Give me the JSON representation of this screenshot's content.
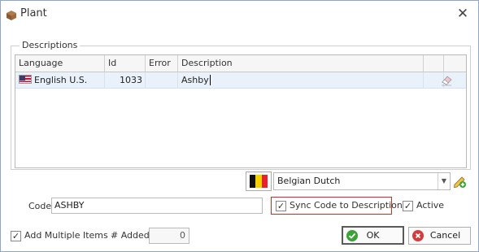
{
  "window": {
    "title": "Plant",
    "close_glyph": "✕"
  },
  "descriptions": {
    "group_label": "Descriptions",
    "columns": [
      "Language",
      "Id",
      "Error",
      "Description"
    ],
    "rows": [
      {
        "language": "English U.S.",
        "id": "1033",
        "error": "",
        "description": "Ashby"
      }
    ],
    "language_selector": {
      "value": "Belgian Dutch"
    }
  },
  "form": {
    "code_label": "Code",
    "code_value": "ASHBY",
    "sync_label": "Sync Code to Description",
    "sync_checked": true,
    "active_label": "Active",
    "active_checked": true,
    "add_multiple_label": "Add Multiple Items",
    "add_multiple_checked": true,
    "added_label": "# Added",
    "added_value": "0"
  },
  "buttons": {
    "ok": "OK",
    "cancel": "Cancel"
  },
  "icons": {
    "app": "plant-box-icon",
    "us_flag": "us-flag-icon",
    "eraser": "eraser-icon",
    "be_flag": "belgium-flag-icon",
    "edit": "pencil-add-icon",
    "ok": "green-check-icon",
    "cancel": "red-x-icon"
  },
  "colors": {
    "ok_icon": "#3aa335",
    "cancel_icon": "#d63a3a",
    "highlight_border": "#d42a2a",
    "row_selected": "#e9f1fb"
  }
}
